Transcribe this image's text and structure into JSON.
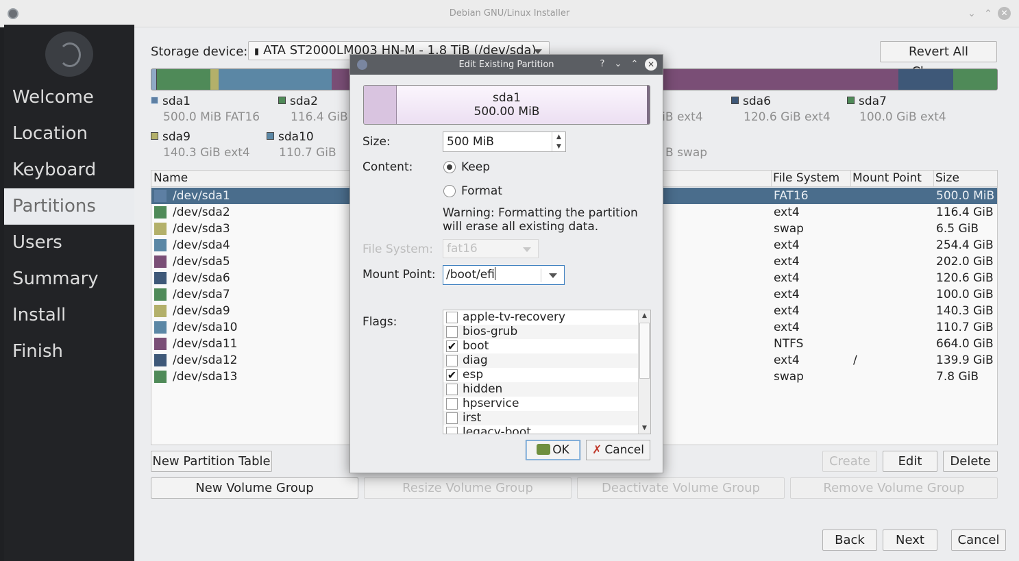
{
  "window": {
    "title": "Debian GNU/Linux Installer",
    "min_icon": "chevron-down-icon",
    "max_icon": "chevron-up-icon",
    "close_icon": "close-icon"
  },
  "sidebar": {
    "items": [
      {
        "label": "Welcome",
        "current": false
      },
      {
        "label": "Location",
        "current": false
      },
      {
        "label": "Keyboard",
        "current": false
      },
      {
        "label": "Partitions",
        "current": true
      },
      {
        "label": "Users",
        "current": false
      },
      {
        "label": "Summary",
        "current": false
      },
      {
        "label": "Install",
        "current": false
      },
      {
        "label": "Finish",
        "current": false
      }
    ]
  },
  "storage": {
    "label": "Storage device:",
    "device": "ATA ST2000LM003 HN-M - 1.8 TiB (/dev/sda)",
    "revert_label": "Revert All Changes"
  },
  "legend": {
    "row1": [
      {
        "name": "sda1",
        "detail": "500.0 MiB  FAT16",
        "color": "#5d7fa3"
      },
      {
        "name": "sda2",
        "detail": "116.4 GiB",
        "color": "#4f8a58"
      },
      {
        "name": "",
        "detail": "GiB  ext4",
        "color": ""
      },
      {
        "name": "sda6",
        "detail": "120.6 GiB  ext4",
        "color": "#3e5878"
      },
      {
        "name": "sda7",
        "detail": "100.0 GiB  ext4",
        "color": "#4f8a58"
      }
    ],
    "row2": [
      {
        "name": "sda9",
        "detail": "140.3 GiB  ext4",
        "color": "#b3b06a"
      },
      {
        "name": "sda10",
        "detail": "110.7 GiB",
        "color": "#5b87a5"
      },
      {
        "name": "",
        "detail": "B  swap",
        "color": ""
      }
    ]
  },
  "table": {
    "headers": {
      "name": "Name",
      "fs": "File System",
      "mount": "Mount Point",
      "size": "Size"
    },
    "rows": [
      {
        "name": "/dev/sda1",
        "fs": "FAT16",
        "mount": "",
        "size": "500.0 MiB",
        "color": "#5d7fa3",
        "selected": true
      },
      {
        "name": "/dev/sda2",
        "fs": "ext4",
        "mount": "",
        "size": "116.4 GiB",
        "color": "#4f8a58"
      },
      {
        "name": "/dev/sda3",
        "fs": "swap",
        "mount": "",
        "size": "6.5 GiB",
        "color": "#b3b06a"
      },
      {
        "name": "/dev/sda4",
        "fs": "ext4",
        "mount": "",
        "size": "254.4 GiB",
        "color": "#5b87a5"
      },
      {
        "name": "/dev/sda5",
        "fs": "ext4",
        "mount": "",
        "size": "202.0 GiB",
        "color": "#7a4e76"
      },
      {
        "name": "/dev/sda6",
        "fs": "ext4",
        "mount": "",
        "size": "120.6 GiB",
        "color": "#3e5878"
      },
      {
        "name": "/dev/sda7",
        "fs": "ext4",
        "mount": "",
        "size": "100.0 GiB",
        "color": "#4f8a58"
      },
      {
        "name": "/dev/sda9",
        "fs": "ext4",
        "mount": "",
        "size": "140.3 GiB",
        "color": "#b3b06a"
      },
      {
        "name": "/dev/sda10",
        "fs": "ext4",
        "mount": "",
        "size": "110.7 GiB",
        "color": "#5b87a5"
      },
      {
        "name": "/dev/sda11",
        "fs": "NTFS",
        "mount": "",
        "size": "664.0 GiB",
        "color": "#7a4e76"
      },
      {
        "name": "/dev/sda12",
        "fs": "ext4",
        "mount": "/",
        "size": "139.9 GiB",
        "color": "#3e5878"
      },
      {
        "name": "/dev/sda13",
        "fs": "swap",
        "mount": "",
        "size": "7.8 GiB",
        "color": "#4f8a58"
      }
    ]
  },
  "buttons": {
    "new_table": "New Partition Table",
    "create": "Create",
    "edit": "Edit",
    "delete": "Delete",
    "new_vg": "New Volume Group",
    "resize_vg": "Resize Volume Group",
    "deactivate_vg": "Deactivate Volume Group",
    "remove_vg": "Remove Volume Group",
    "back": "Back",
    "next": "Next",
    "cancel": "Cancel"
  },
  "dialog": {
    "title": "Edit Existing Partition",
    "help_icon": "?",
    "partition_name": "sda1",
    "partition_size": "500.00 MiB",
    "size_label": "Size:",
    "size_value": "500 MiB",
    "content_label": "Content:",
    "keep_label": "Keep",
    "format_label": "Format",
    "warning": "Warning: Formatting the partition will erase all existing data.",
    "fs_label": "File System:",
    "fs_value": "fat16",
    "mount_label": "Mount Point:",
    "mount_value": "/boot/efi",
    "flags_label": "Flags:",
    "flags": [
      {
        "label": "apple-tv-recovery",
        "checked": false
      },
      {
        "label": "bios-grub",
        "checked": false
      },
      {
        "label": "boot",
        "checked": true
      },
      {
        "label": "diag",
        "checked": false
      },
      {
        "label": "esp",
        "checked": true
      },
      {
        "label": "hidden",
        "checked": false
      },
      {
        "label": "hpservice",
        "checked": false
      },
      {
        "label": "irst",
        "checked": false
      },
      {
        "label": "legacy-boot",
        "checked": false
      }
    ],
    "ok_label": "OK",
    "cancel_label": "Cancel"
  }
}
